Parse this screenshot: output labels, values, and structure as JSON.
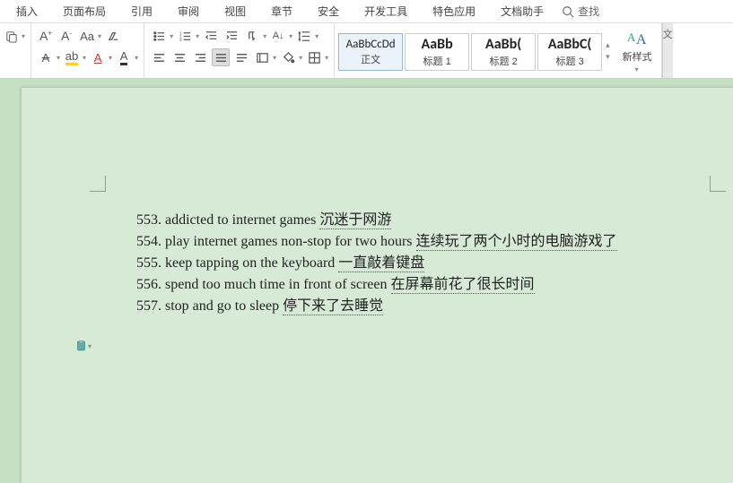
{
  "menu": {
    "items": [
      "插入",
      "页面布局",
      "引用",
      "审阅",
      "视图",
      "章节",
      "安全",
      "开发工具",
      "特色应用",
      "文档助手"
    ],
    "search": "查找"
  },
  "toolbar": {
    "font": {
      "grow": "A",
      "shrink": "A",
      "case": "Aa",
      "clear": "⌫",
      "strike": "A",
      "format": "ab",
      "under": "A",
      "color": "A"
    },
    "para": {
      "align_just": true
    }
  },
  "styles": {
    "items": [
      {
        "preview": "AaBbCcDd",
        "label": "正文",
        "big": false,
        "sel": true
      },
      {
        "preview": "AaBb",
        "label": "标题 1",
        "big": true,
        "sel": false
      },
      {
        "preview": "AaBb(",
        "label": "标题 2",
        "big": true,
        "sel": false
      },
      {
        "preview": "AaBbC(",
        "label": "标题 3",
        "big": true,
        "sel": false
      }
    ],
    "newstyle": "新样式"
  },
  "rightbar": "文",
  "doc": {
    "lines": [
      {
        "n": "553.",
        "en": "addicted to internet games ",
        "cn": "沉迷于网游"
      },
      {
        "n": "554.",
        "en": "play internet games non-stop for two hours ",
        "cn": "连续玩了两个小时的电脑游戏了"
      },
      {
        "n": "555.",
        "en": "keep tapping on the keyboard ",
        "cn": "一直敲着键盘"
      },
      {
        "n": "556.",
        "en": "spend too much time in front of screen ",
        "cn": "在屏幕前花了很长时间"
      },
      {
        "n": "557.",
        "en": "stop and go to sleep ",
        "cn": "停下来了去睡觉"
      }
    ]
  }
}
